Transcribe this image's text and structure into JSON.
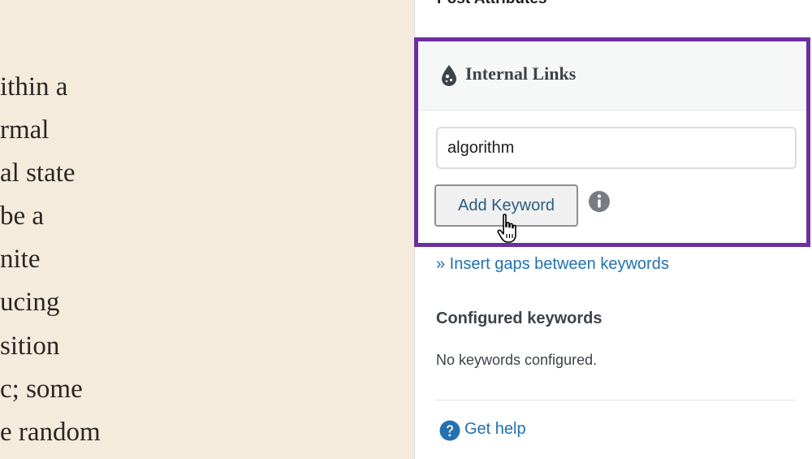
{
  "editor": {
    "lines": [
      "ithin a",
      "rmal",
      "al state",
      "be a",
      "nite",
      "ucing",
      "sition",
      "c; some",
      "e random"
    ]
  },
  "post_attributes": {
    "label": "Post Attributes",
    "chevron_icon": "chevron-down-icon"
  },
  "internal_links": {
    "title": "Internal Links",
    "icon": "drop-icon",
    "keyword_input_value": "algorithm",
    "add_button_label": "Add Keyword",
    "info_icon": "info-icon",
    "insert_gaps_link": "» Insert gaps between keywords",
    "configured_heading": "Configured keywords",
    "configured_empty": "No keywords configured.",
    "help_icon": "question-circle-icon",
    "help_link": "Get help"
  },
  "colors": {
    "highlight_border": "#6b2fa0",
    "link": "#2271b1",
    "editor_background": "#f5ebdd"
  }
}
